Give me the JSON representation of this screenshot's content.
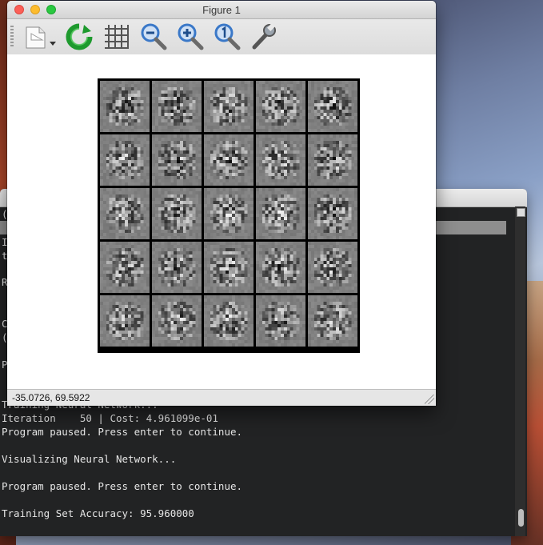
{
  "figure": {
    "title": "Figure 1",
    "status": "-35.0726,  69.5922",
    "toolbar": {
      "icons": [
        "edit-menu-icon",
        "refresh-icon",
        "grid-icon",
        "zoom-out-icon",
        "zoom-in-icon",
        "zoom-reset-icon",
        "settings-wrench-icon"
      ]
    },
    "image_grid": {
      "rows": 5,
      "cols": 5,
      "content": "hidden-layer weight visualizations (grayscale)"
    }
  },
  "terminal": {
    "partial_lines": [
      "(",
      "I",
      "t",
      "R",
      "C",
      "(",
      "P"
    ],
    "lines": [
      "Training Neural Network...",
      "Iteration    50 | Cost: 4.961099e-01",
      "Program paused. Press enter to continue.",
      "",
      "Visualizing Neural Network...",
      "",
      "Program paused. Press enter to continue.",
      "",
      "Training Set Accuracy: 95.960000"
    ]
  },
  "colors": {
    "terminal_bg": "#222324",
    "terminal_text": "#e6e6e6",
    "close": "#fc5f57",
    "minimize": "#fdbc2e",
    "maximize": "#29c840",
    "refresh_green": "#1e9a2e",
    "zoom_blue": "#3a78c8"
  }
}
